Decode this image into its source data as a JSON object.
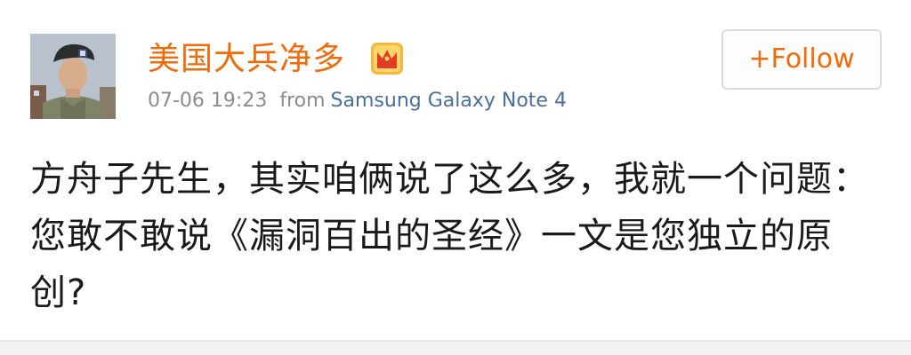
{
  "post": {
    "author": "美国大兵净多",
    "time": "07-06 19:23",
    "from_label": "from",
    "source": "Samsung Galaxy Note 4",
    "follow_label": "+Follow",
    "content": "方舟子先生，其实咱俩说了这么多，我就一个问题：您敢不敢说《漏洞百出的圣经》一文是您独立的原创?"
  },
  "icons": {
    "avatar": "user-avatar-photo",
    "vip": "crown-badge-icon"
  },
  "colors": {
    "accent": "#f26b0a",
    "source_link": "#4a6e9d",
    "meta_text": "#8c8c8c"
  }
}
